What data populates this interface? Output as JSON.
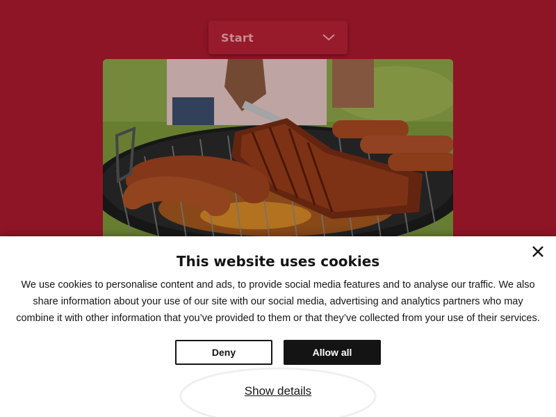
{
  "background": {
    "color": "#8e1526",
    "dropdown": {
      "selected": "Start",
      "icon": "chevron-down-icon"
    },
    "hero_image": {
      "subject": "barbecue-grill-image"
    }
  },
  "cookie_banner": {
    "title": "This website uses cookies",
    "body": "We use cookies to personalise content and ads, to provide social media features and to analyse our traffic. We also share information about your use of our site with our social media, advertising and analytics partners who may combine it with other information that you’ve provided to them or that they’ve collected from your use of their services.",
    "deny_label": "Deny",
    "allow_label": "Allow all",
    "details_label": "Show details",
    "close_icon": "close-icon"
  },
  "colors": {
    "brand_red": "#8e1526",
    "button_dark": "#141414",
    "text": "#141414"
  }
}
